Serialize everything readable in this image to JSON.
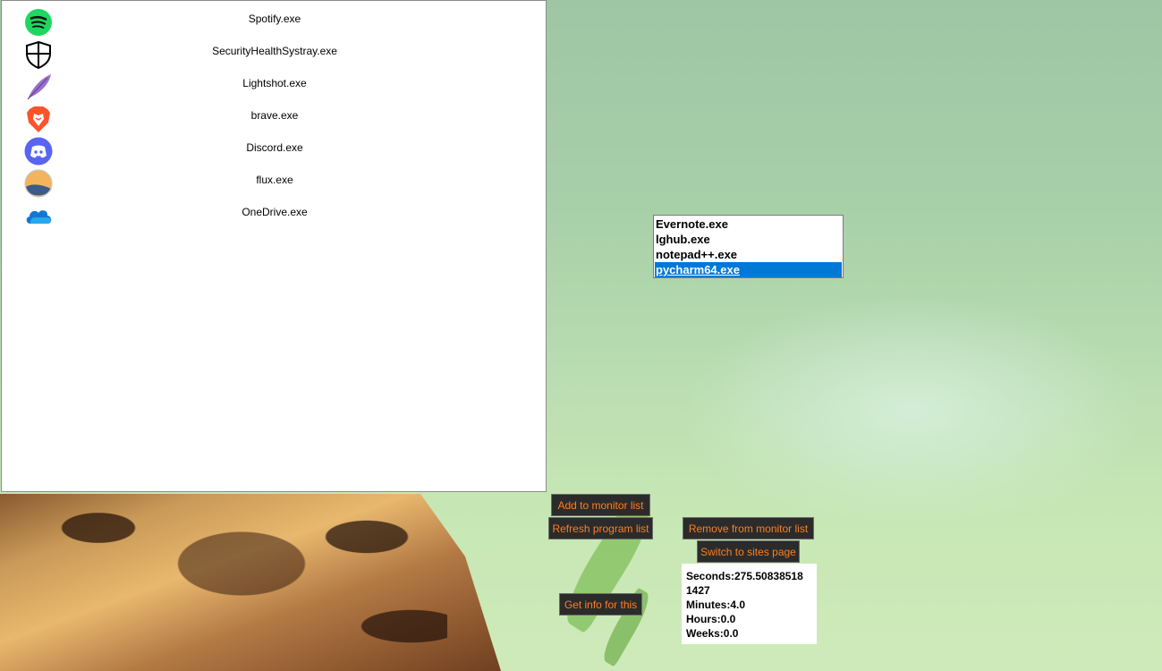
{
  "programs": [
    {
      "name": "Spotify.exe",
      "icon": "spotify-icon"
    },
    {
      "name": "SecurityHealthSystray.exe",
      "icon": "shield-icon"
    },
    {
      "name": "Lightshot.exe",
      "icon": "feather-icon"
    },
    {
      "name": "brave.exe",
      "icon": "brave-lion-icon"
    },
    {
      "name": "Discord.exe",
      "icon": "discord-icon"
    },
    {
      "name": "flux.exe",
      "icon": "flux-icon"
    },
    {
      "name": "OneDrive.exe",
      "icon": "cloud-icon"
    }
  ],
  "monitor_list": {
    "items": [
      "Evernote.exe",
      "lghub.exe",
      "notepad++.exe",
      "pycharm64.exe"
    ],
    "selected": "pycharm64.exe"
  },
  "buttons": {
    "add": "Add to monitor list",
    "refresh": "Refresh program list",
    "remove": "Remove from monitor list",
    "switch": "Switch to sites page",
    "info": "Get info for this"
  },
  "info": {
    "seconds_line1": "Seconds:275.50838518",
    "seconds_line2": "1427",
    "minutes": "Minutes:4.0",
    "hours": "Hours:0.0",
    "weeks": "Weeks:0.0"
  },
  "colors": {
    "button_bg": "#2b2b2b",
    "button_text": "#ff7e1f",
    "selection": "#0078d7"
  }
}
